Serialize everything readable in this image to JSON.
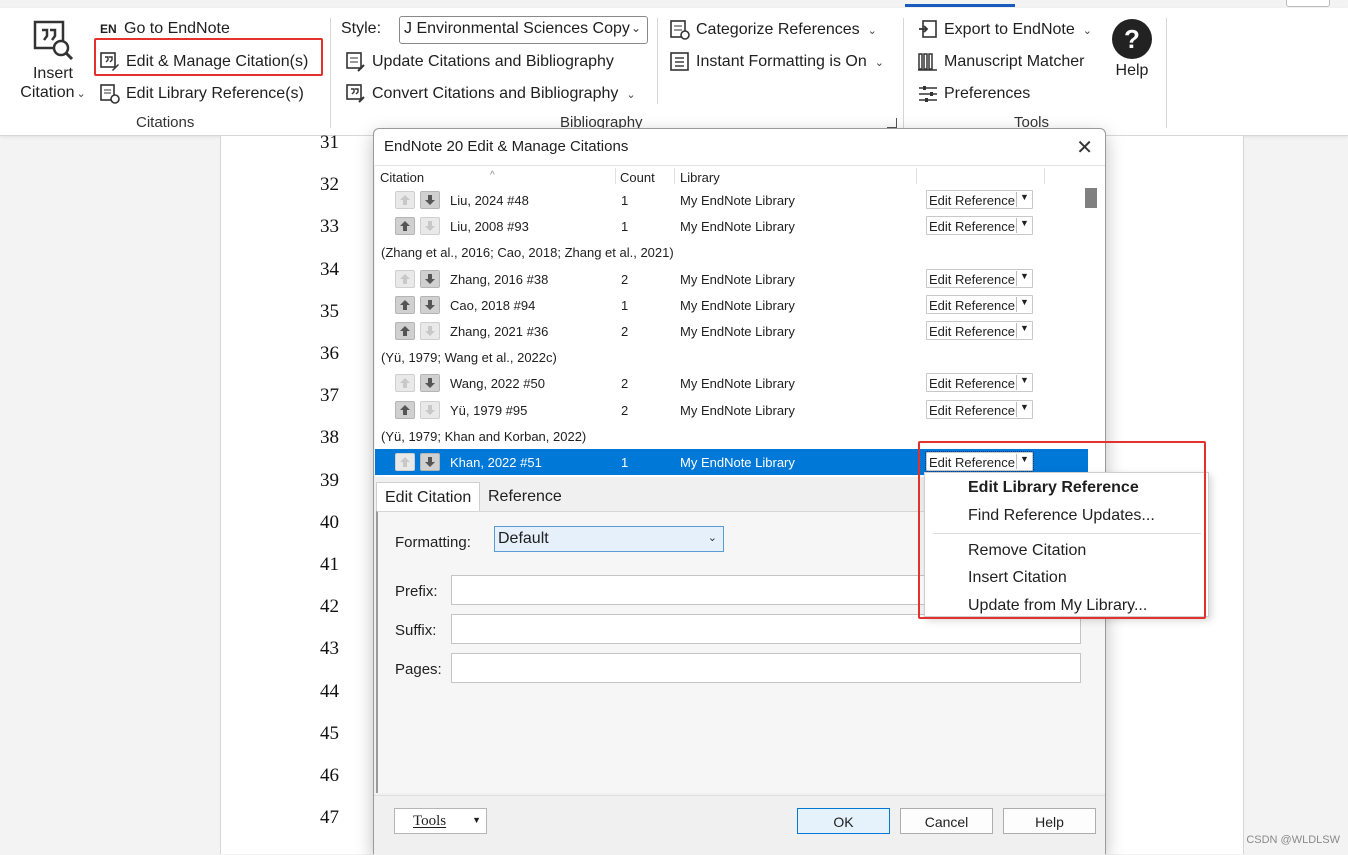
{
  "ribbon": {
    "citations": {
      "insert_citation_line1": "Insert",
      "insert_citation_line2": "Citation",
      "go_to_endnote_badge": "EN",
      "go_to_endnote": "Go to EndNote",
      "edit_manage": "Edit & Manage Citation(s)",
      "edit_library_ref": "Edit Library Reference(s)",
      "group_label": "Citations"
    },
    "bibliography": {
      "style_label": "Style:",
      "style_value": "J Environmental Sciences Copy",
      "update_citations": "Update Citations and Bibliography",
      "convert_citations": "Convert Citations and Bibliography",
      "categorize_references": "Categorize References",
      "instant_formatting": "Instant Formatting is On",
      "group_label": "Bibliography"
    },
    "tools": {
      "export": "Export to EndNote",
      "manuscript_matcher": "Manuscript Matcher",
      "preferences": "Preferences",
      "help": "Help",
      "group_label": "Tools"
    }
  },
  "document": {
    "line_numbers": [
      "31",
      "32",
      "33",
      "34",
      "35",
      "36",
      "37",
      "38",
      "39",
      "40",
      "41",
      "42",
      "43",
      "44",
      "45",
      "46",
      "47"
    ]
  },
  "dialog": {
    "title": "EndNote 20 Edit & Manage Citations",
    "close_glyph": "✕",
    "columns": {
      "citation": "Citation",
      "count": "Count",
      "library": "Library"
    },
    "edit_reference_label": "Edit Reference",
    "rows": [
      {
        "type": "ref",
        "label": "Liu, 2024 #48",
        "count": "1",
        "library": "My EndNote Library",
        "up": false,
        "down": true
      },
      {
        "type": "ref",
        "label": "Liu, 2008 #93",
        "count": "1",
        "library": "My EndNote Library",
        "up": true,
        "down": false
      },
      {
        "type": "group",
        "label": "(Zhang et al., 2016; Cao, 2018; Zhang et al., 2021)"
      },
      {
        "type": "ref",
        "label": "Zhang, 2016 #38",
        "count": "2",
        "library": "My EndNote Library",
        "up": false,
        "down": true
      },
      {
        "type": "ref",
        "label": "Cao, 2018 #94",
        "count": "1",
        "library": "My EndNote Library",
        "up": true,
        "down": true
      },
      {
        "type": "ref",
        "label": "Zhang, 2021 #36",
        "count": "2",
        "library": "My EndNote Library",
        "up": true,
        "down": false
      },
      {
        "type": "group",
        "label": "(Yü, 1979; Wang et al., 2022c)"
      },
      {
        "type": "ref",
        "label": "Wang, 2022 #50",
        "count": "2",
        "library": "My EndNote Library",
        "up": false,
        "down": true
      },
      {
        "type": "ref",
        "label": "Yü, 1979 #95",
        "count": "2",
        "library": "My EndNote Library",
        "up": true,
        "down": false
      },
      {
        "type": "group",
        "label": "(Yü, 1979; Khan and Korban, 2022)"
      },
      {
        "type": "ref",
        "label": "Khan, 2022 #51",
        "count": "1",
        "library": "My EndNote Library",
        "up": false,
        "down": true,
        "selected": true
      }
    ],
    "tabs": [
      "Edit Citation",
      "Reference"
    ],
    "fields": {
      "formatting_label": "Formatting:",
      "formatting_value": "Default",
      "prefix_label": "Prefix:",
      "suffix_label": "Suffix:",
      "pages_label": "Pages:",
      "prefix_value": "",
      "suffix_value": "",
      "pages_value": ""
    },
    "footer": {
      "tools": "Tools",
      "ok": "OK",
      "cancel": "Cancel",
      "help": "Help"
    }
  },
  "context_menu": {
    "items": [
      "Edit Library Reference",
      "Find Reference Updates...",
      "Remove Citation",
      "Insert Citation",
      "Update from My Library..."
    ]
  },
  "watermark": "CSDN @WLDLSW",
  "colors": {
    "accent": "#0078d7",
    "highlight": "#e3312d",
    "selection": "#0078d7"
  }
}
